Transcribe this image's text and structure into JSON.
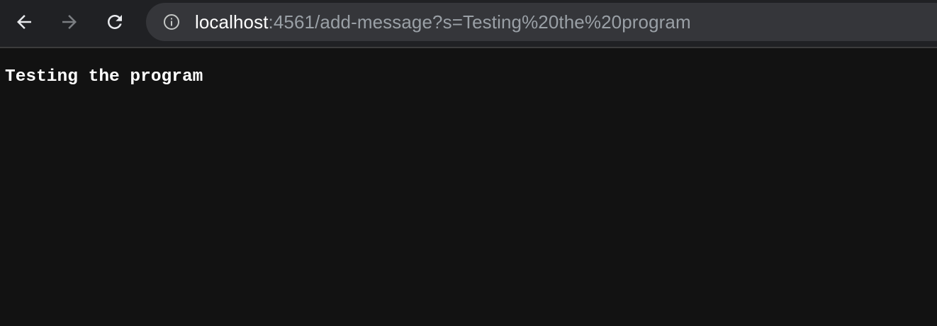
{
  "browser": {
    "back_icon": "arrow-left-icon",
    "forward_icon": "arrow-right-icon",
    "reload_icon": "reload-icon",
    "site_info_icon": "info-icon",
    "address": {
      "host": "localhost",
      "rest": ":4561/add-message?s=Testing%20the%20program"
    }
  },
  "page": {
    "message": "Testing the program"
  },
  "colors": {
    "toolbar_bg": "#202124",
    "omnibox_bg": "#35363a",
    "page_bg": "#121212",
    "url_dim": "#9aa0a6",
    "text": "#ffffff"
  }
}
